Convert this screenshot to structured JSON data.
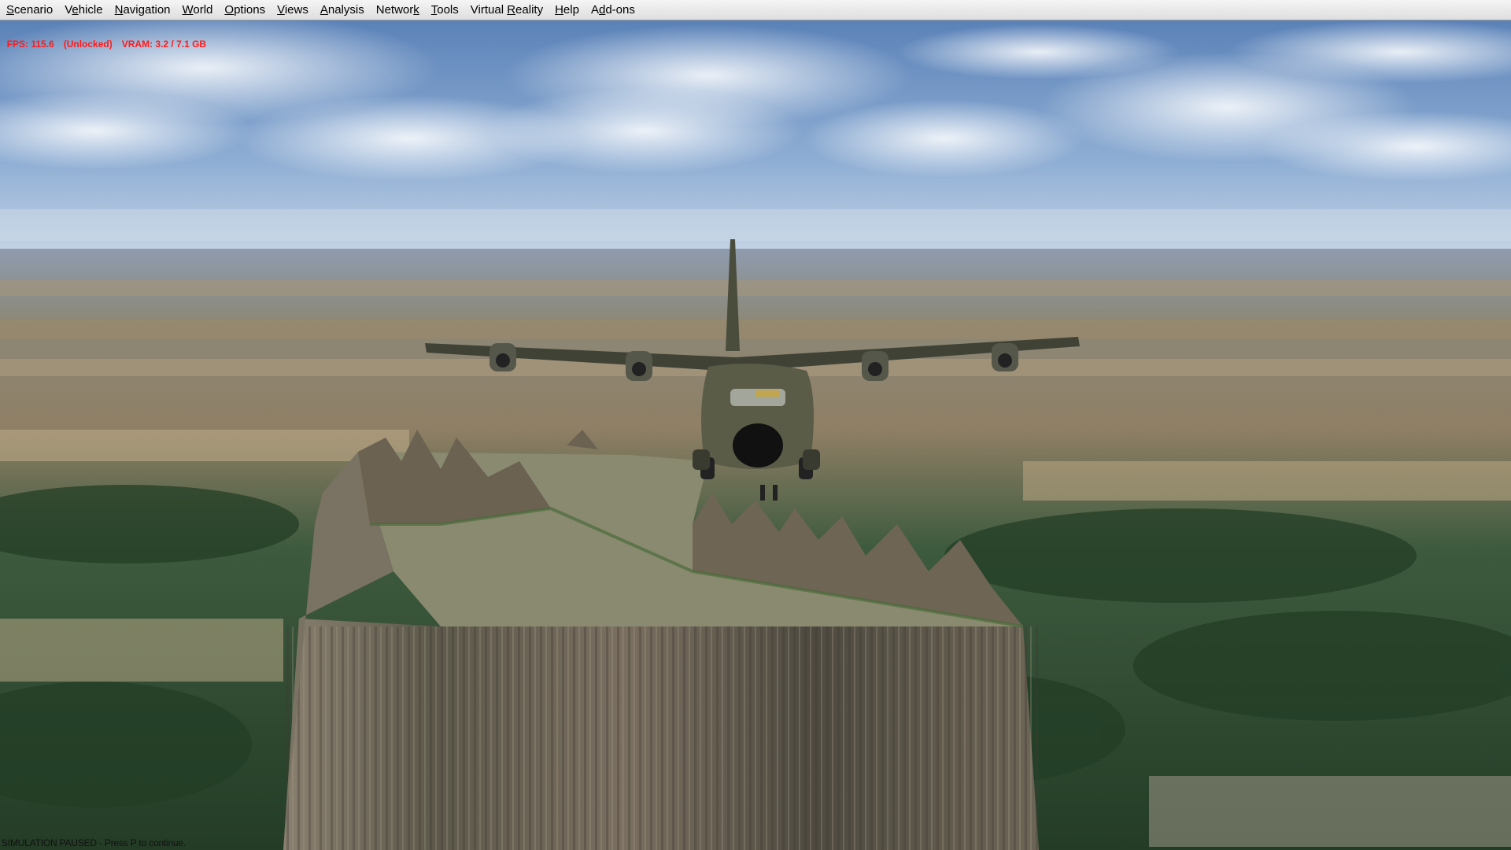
{
  "menu": {
    "items": [
      {
        "label": "Scenario",
        "accel": "S"
      },
      {
        "label": "Vehicle",
        "accel": "e"
      },
      {
        "label": "Navigation",
        "accel": "N"
      },
      {
        "label": "World",
        "accel": "W"
      },
      {
        "label": "Options",
        "accel": "O"
      },
      {
        "label": "Views",
        "accel": "V"
      },
      {
        "label": "Analysis",
        "accel": "A"
      },
      {
        "label": "Network",
        "accel": "k"
      },
      {
        "label": "Tools",
        "accel": "T"
      },
      {
        "label": "Virtual Reality",
        "accel": "R"
      },
      {
        "label": "Help",
        "accel": "H"
      },
      {
        "label": "Add-ons",
        "accel": "d"
      }
    ]
  },
  "hud": {
    "fps": "FPS: 115.6",
    "lock": "(Unlocked)",
    "vram": "VRAM: 3.2 / 7.1 GB"
  },
  "status": {
    "message": "SIMULATION PAUSED - Press P to continue."
  },
  "colors": {
    "hud_text": "#ff1a1a",
    "sky_top": "#5b82b8",
    "horizon": "#c7d6e6",
    "forest": "#2d4a2e",
    "rock": "#6f6858"
  }
}
